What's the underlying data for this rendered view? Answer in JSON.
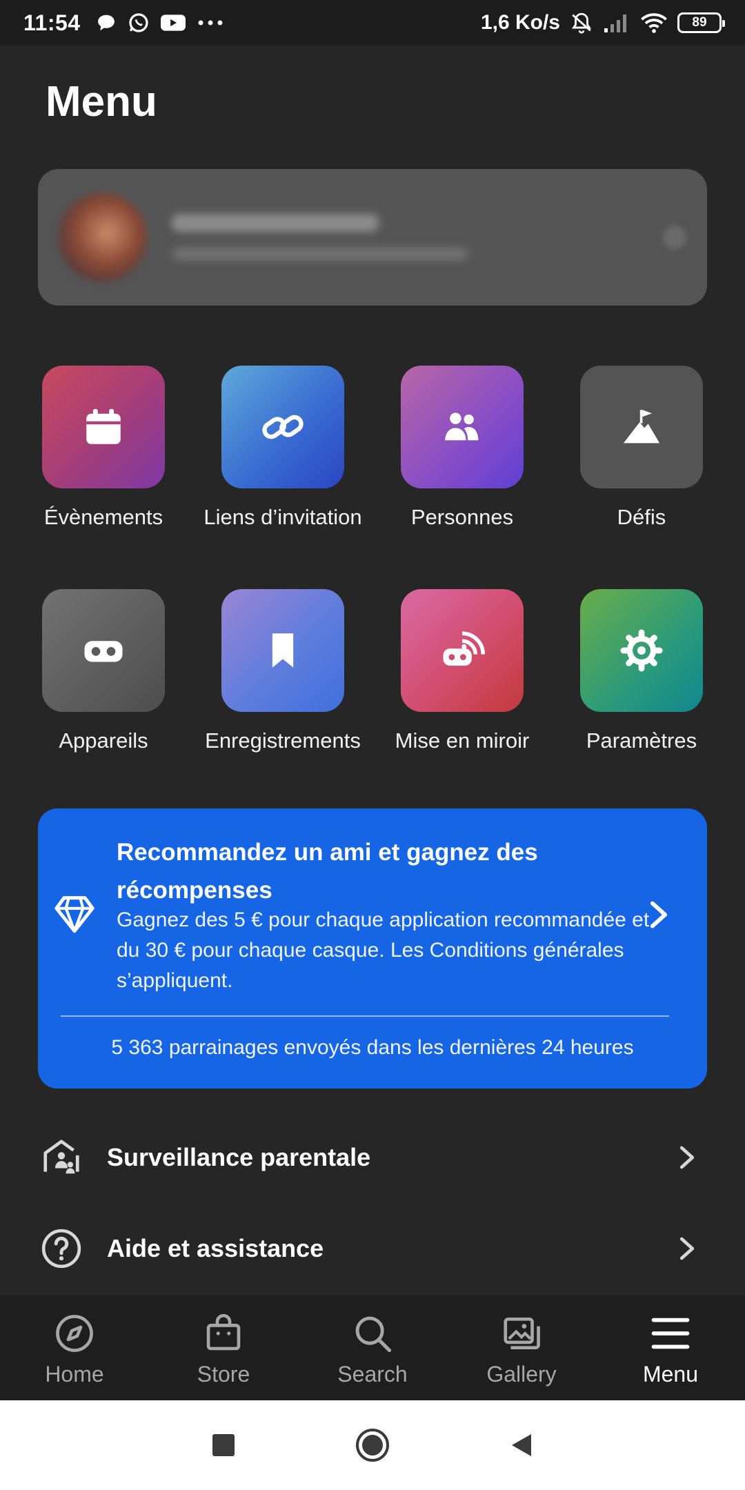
{
  "status_bar": {
    "time": "11:54",
    "speed": "1,6 Ko/s",
    "battery": "89",
    "icons": [
      "chat-bubble-icon",
      "whatsapp-icon",
      "youtube-icon",
      "more-dots-icon",
      "mute-icon",
      "signal-icon",
      "wifi-icon",
      "battery-icon"
    ]
  },
  "page": {
    "title": "Menu"
  },
  "grid": {
    "items": [
      {
        "label": "Évènements",
        "icon": "calendar-icon"
      },
      {
        "label": "Liens d’invitation",
        "icon": "link-icon"
      },
      {
        "label": "Personnes",
        "icon": "people-icon"
      },
      {
        "label": "Défis",
        "icon": "mountain-flag-icon"
      },
      {
        "label": "Appareils",
        "icon": "vr-headset-icon"
      },
      {
        "label": "Enregistrements",
        "icon": "bookmark-icon"
      },
      {
        "label": "Mise en miroir",
        "icon": "cast-icon"
      },
      {
        "label": "Paramètres",
        "icon": "gear-icon"
      }
    ]
  },
  "referral": {
    "title": "Recommandez un ami et gagnez des récompenses",
    "body": "Gagnez des 5 € pour chaque application recommandée et du 30 € pour chaque casque. Les Conditions générales s’appliquent.",
    "count": "5 363 parrainages envoyés dans les dernières 24 heures",
    "icon": "diamond-icon"
  },
  "rows": [
    {
      "label": "Surveillance parentale",
      "icon": "family-home-icon"
    },
    {
      "label": "Aide et assistance",
      "icon": "help-icon"
    }
  ],
  "bottom_nav": [
    {
      "label": "Home",
      "icon": "compass-icon"
    },
    {
      "label": "Store",
      "icon": "store-bag-icon"
    },
    {
      "label": "Search",
      "icon": "search-icon"
    },
    {
      "label": "Gallery",
      "icon": "gallery-icon"
    },
    {
      "label": "Menu",
      "icon": "hamburger-icon",
      "active": true
    }
  ],
  "system_nav": [
    "recents-icon",
    "home-icon",
    "back-icon"
  ]
}
